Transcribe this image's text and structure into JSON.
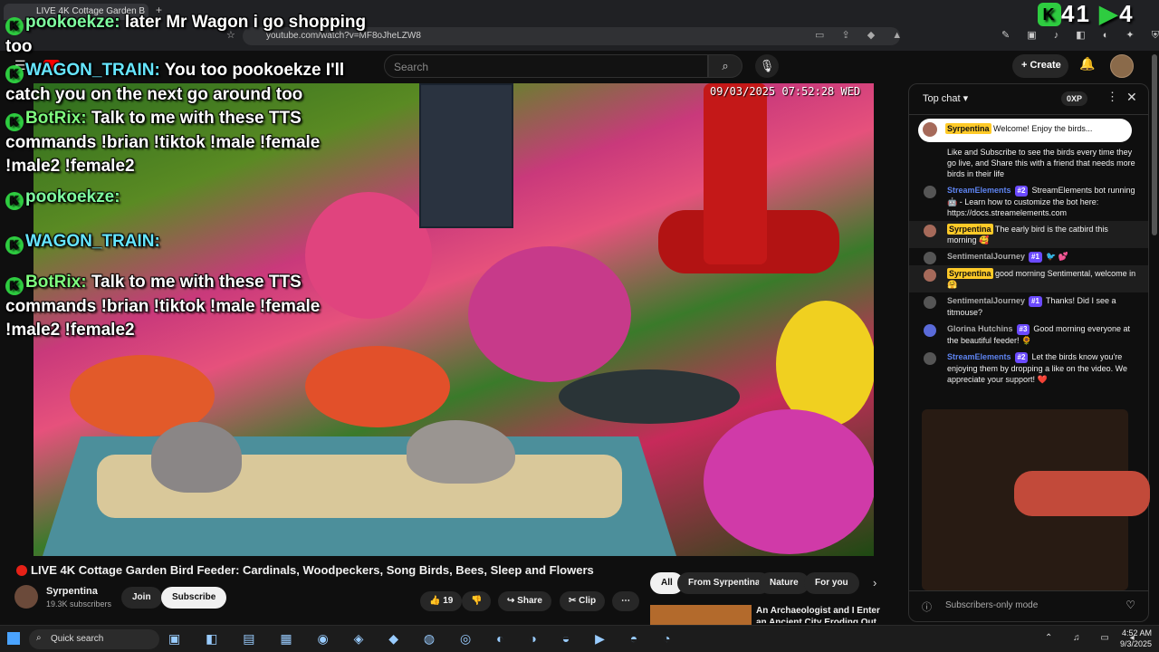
{
  "browser": {
    "tab_title": "LIVE 4K Cottage Garden B",
    "url": "youtube.com/watch?v=MF8oJheLZW8"
  },
  "youtube": {
    "search_placeholder": "Search",
    "create_label": "Create"
  },
  "video": {
    "timestamp": "09/03/2025 07:52:28 WED",
    "title": "LIVE 4K Cottage Garden Bird Feeder: Cardinals, Woodpeckers, Song Birds, Bees, Sleep and Flowers",
    "channel": "Syrpentina",
    "subscribers": "19.3K subscribers",
    "join_label": "Join",
    "subscribe_label": "Subscribe",
    "likes": "19",
    "share_label": "Share",
    "clip_label": "Clip"
  },
  "chips": [
    "All",
    "From Syrpentina",
    "Nature",
    "For you"
  ],
  "recommended": {
    "title": "An Archaeologist and I Enter an Ancient City Eroding Out of th..."
  },
  "overlay_chat": [
    {
      "name": "pookoekze:",
      "text": "later Mr Wagon i go shopping too"
    },
    {
      "name": "WAGON_TRAIN:",
      "text": "You too pookoekze I'll catch you on the next go around too"
    },
    {
      "name": "BotRix:",
      "text": "Talk to me with these TTS commands !brian !tiktok !male !female !male2 !female2"
    },
    {
      "name": "pookoekze:",
      "text": ""
    },
    {
      "name": "WAGON_TRAIN:",
      "text": ""
    },
    {
      "name": "BotRix:",
      "text": "Talk to me with these TTS commands !brian !tiktok !male !female !male2 !female2"
    }
  ],
  "counter": {
    "left": "41",
    "right": "4"
  },
  "chat": {
    "header": "Top chat",
    "points": "0XP",
    "pinned_name": "Syrpentina",
    "pinned_text": "Welcome! Enjoy the birds...",
    "messages": [
      {
        "name": "",
        "badge": "",
        "text": "Like and Subscribe to see the birds every time they go live, and Share this with a friend that needs more birds in their life"
      },
      {
        "name": "StreamElements",
        "badge": "#2",
        "text": "StreamElements bot running 🤖 - Learn how to customize the bot here: https://docs.streamelements.com"
      },
      {
        "name": "Syrpentina",
        "badge": "",
        "text": "The early bird is the catbird this morning 🥰"
      },
      {
        "name": "SentimentalJourney",
        "badge": "#1",
        "text": "🐦 💕"
      },
      {
        "name": "Syrpentina",
        "badge": "",
        "text": "good morning Sentimental, welcome in 🤗"
      },
      {
        "name": "SentimentalJourney",
        "badge": "#1",
        "text": "Thanks! Did I see a titmouse?"
      },
      {
        "name": "Glorina Hutchins",
        "badge": "#3",
        "text": "Good morning everyone at the beautiful feeder! 🌻"
      },
      {
        "name": "StreamElements",
        "badge": "#2",
        "text": "Let the birds know you're enjoying them by dropping a like on the video. We appreciate your support! ❤️"
      }
    ],
    "footer": "Subscribers-only mode"
  },
  "taskbar": {
    "search_label": "Quick search",
    "time": "4:52 AM",
    "date": "9/3/2025"
  }
}
